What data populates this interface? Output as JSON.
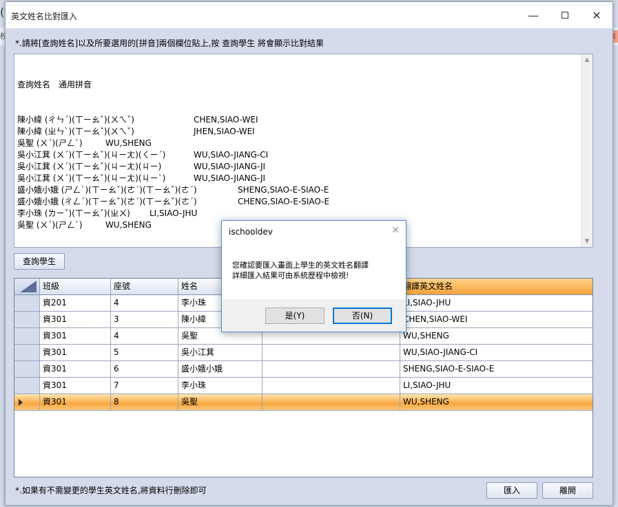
{
  "background": {
    "left_text": "(",
    "strip_left": "校",
    "strip_right": "未"
  },
  "window": {
    "title": "英文姓名比對匯入",
    "minimize": "—",
    "close": "✕"
  },
  "instruction": "*.請將[查詢姓名]以及所要選用的[拼音]兩個欄位貼上,按 查詢學生 將會顯示比對結果",
  "textbox": {
    "header": "查詢姓名　通用拼音",
    "lines": [
      {
        "zh": "陳小緯 (ㄔㄣˊ)(ㄒㄧㄠˇ)(ㄨㄟˇ)",
        "en": "CHEN,SIAO-WEI"
      },
      {
        "zh": "陳小緯 (ㄓㄣˋ)(ㄒㄧㄠˇ)(ㄨㄟˇ)",
        "en": "JHEN,SIAO-WEI"
      },
      {
        "zh": "吳聖 (ㄨˊ)(ㄕㄥˋ)",
        "en": "WU,SHENG"
      },
      {
        "zh": "吳小江萁 (ㄨˊ)(ㄒㄧㄠˇ)(ㄐㄧㄤ)(ㄑㄧˊ)",
        "en": "WU,SIAO-JIANG-CI"
      },
      {
        "zh": "吳小江萁 (ㄨˊ)(ㄒㄧㄠˇ)(ㄐㄧㄤ)(ㄐㄧ)",
        "en": "WU,SIAO-JIANG-JI"
      },
      {
        "zh": "吳小江萁 (ㄨˊ)(ㄒㄧㄠˇ)(ㄐㄧㄤ)(ㄐㄧˋ)",
        "en": "WU,SIAO-JIANG-JI"
      },
      {
        "zh": "盛小娥小娥 (ㄕㄥˋ)(ㄒㄧㄠˇ)(ㄜˊ)(ㄒㄧㄠˇ)(ㄜˊ)",
        "en": "SHENG,SIAO-E-SIAO-E"
      },
      {
        "zh": "盛小娥小娥 (ㄔㄥˊ)(ㄒㄧㄠˇ)(ㄜˊ)(ㄒㄧㄠˇ)(ㄜˊ)",
        "en": "CHENG,SIAO-E-SIAO-E"
      },
      {
        "zh": "李小珠 (ㄌㄧˇ)(ㄒㄧㄠˇ)(ㄓㄨ)",
        "en": "LI,SIAO-JHU"
      },
      {
        "zh": "吳聖 (ㄨˊ)(ㄕㄥˋ)",
        "en": "WU,SHENG"
      }
    ]
  },
  "query_button": "查詢學生",
  "grid": {
    "columns": [
      "班級",
      "座號",
      "姓名",
      "",
      "翻譯英文姓名"
    ],
    "rows": [
      {
        "class": "資201",
        "seat": "4",
        "name": "李小珠",
        "extra": "",
        "english": "LI,SIAO-JHU"
      },
      {
        "class": "資301",
        "seat": "3",
        "name": "陳小緯",
        "extra": "",
        "english": "CHEN,SIAO-WEI"
      },
      {
        "class": "資301",
        "seat": "4",
        "name": "吳聖",
        "extra": "",
        "english": "WU,SHENG"
      },
      {
        "class": "資301",
        "seat": "5",
        "name": "吳小江萁",
        "extra": "",
        "english": "WU,SIAO-JIANG-CI"
      },
      {
        "class": "資301",
        "seat": "6",
        "name": "盛小娥小娥",
        "extra": "",
        "english": "SHENG,SIAO-E-SIAO-E"
      },
      {
        "class": "資301",
        "seat": "7",
        "name": "李小珠",
        "extra": "",
        "english": "LI,SIAO-JHU"
      },
      {
        "class": "資301",
        "seat": "8",
        "name": "吳聖",
        "extra": "",
        "english": "WU,SHENG"
      }
    ],
    "selected_row": 6
  },
  "note": "*.如果有不需變更的學生英文姓名,將資料行刪除即可",
  "import_button": "匯入",
  "leave_button": "離開",
  "dialog": {
    "title": "ischooldev",
    "close": "✕",
    "message_line1": "您確認要匯入畫面上學生的英文姓名翻譯",
    "message_line2": "詳細匯入結果可由系統歷程中檢視!",
    "yes": "是(Y)",
    "no": "否(N)"
  }
}
